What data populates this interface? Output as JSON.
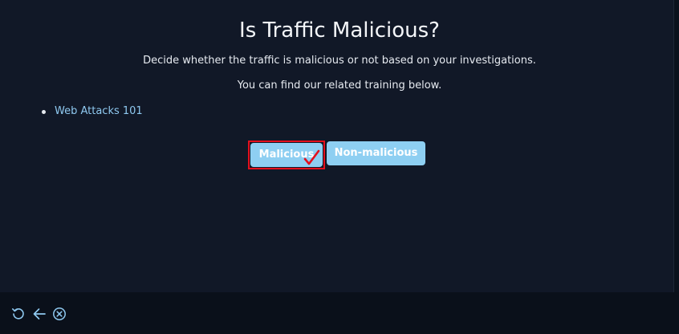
{
  "header": {
    "title": "Is Traffic Malicious?",
    "instruction": "Decide whether the traffic is malicious or not based on your investigations.",
    "training_note": "You can find our related training below."
  },
  "training": {
    "items": [
      {
        "label": "Web Attacks 101"
      }
    ]
  },
  "actions": {
    "malicious_label": "Malicious",
    "non_malicious_label": "Non-malicious",
    "selected": "Malicious"
  },
  "colors": {
    "background": "#111827",
    "button": "#8ecff2",
    "link": "#8fc9f0",
    "selection_outline": "#e4101d"
  },
  "footer": {
    "icons": [
      "refresh-icon",
      "back-arrow-icon",
      "close-circle-icon"
    ]
  }
}
